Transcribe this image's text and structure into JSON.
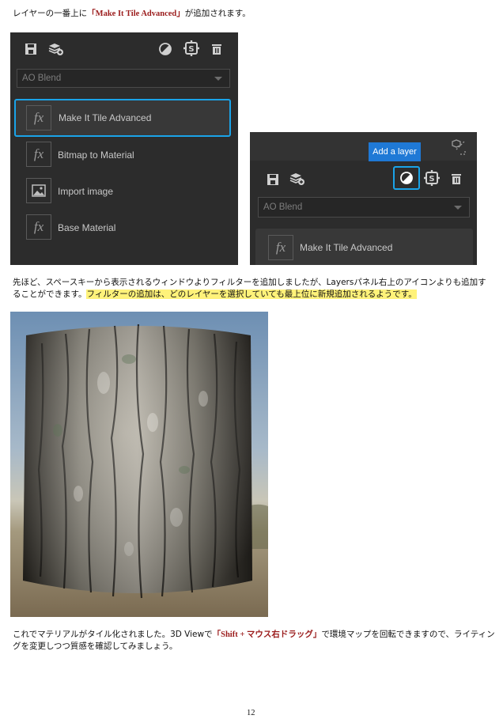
{
  "intro": {
    "before": "レイヤーの一番上に",
    "highlight": "「Make It Tile Advanced」",
    "after": "が追加されます。"
  },
  "panel1": {
    "blend_value": "AO Blend",
    "layers": [
      {
        "icon": "fx",
        "label": "Make It Tile Advanced",
        "selected": true
      },
      {
        "icon": "fx",
        "label": "Bitmap to Material",
        "selected": false
      },
      {
        "icon": "image",
        "label": "Import image",
        "selected": false
      },
      {
        "icon": "fx",
        "label": "Base Material",
        "selected": false
      }
    ]
  },
  "panel2": {
    "tooltip": "Add a layer",
    "blend_value": "AO Blend",
    "layers": [
      {
        "icon": "fx",
        "label": "Make It Tile Advanced"
      }
    ]
  },
  "para2": {
    "line1": "先ほど、スペースキーから表示されるウィンドウよりフィルターを追加しましたが、Layersパネル右上のアイコンよりも追加す",
    "line2_plain": "ることができます。",
    "line2_highlight": "フィルターの追加は、どのレイヤーを選択していても最上位に新規追加されるようです。"
  },
  "para3": {
    "line1_before": "これでマテリアルがタイル化されました。3D Viewで",
    "line1_highlight": "「Shift + マウス右ドラッグ」",
    "line1_after": "で環境マップを回転できますので、ライティン",
    "line2": "グを変更しつつ質感を確認してみましょう。"
  },
  "page_number": "12",
  "colors": {
    "panel_bg": "#2c2c2c",
    "selection": "#1aa3e8",
    "tooltip": "#1f79d6",
    "red_text": "#9b1c1c",
    "highlight": "#fff27a"
  }
}
